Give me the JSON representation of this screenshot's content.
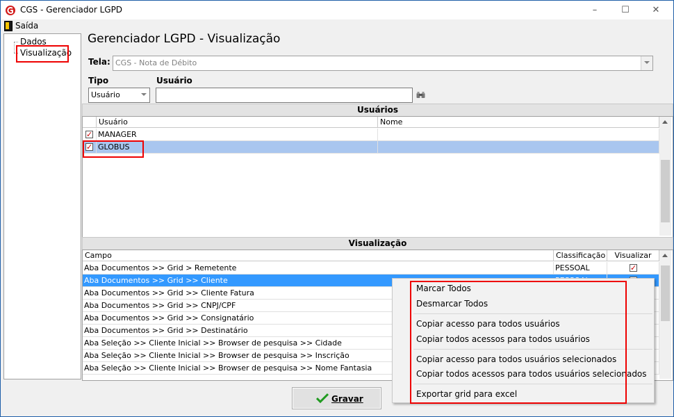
{
  "window": {
    "title": "CGS - Gerenciador LGPD"
  },
  "menu": {
    "saida": "Saída"
  },
  "tree": {
    "items": [
      "Dados",
      "Visualização"
    ]
  },
  "page": {
    "title": "Gerenciador LGPD - Visualização"
  },
  "form": {
    "tela_label": "Tela:",
    "tela_value": "CGS - Nota de Débito",
    "tipo_label": "Tipo",
    "tipo_value": "Usuário",
    "usuario_label": "Usuário",
    "usuario_value": ""
  },
  "usuarios": {
    "caption": "Usuários",
    "columns": [
      "Usuário",
      "Nome"
    ],
    "rows": [
      {
        "usuario": "MANAGER",
        "nome": "",
        "checked": true
      },
      {
        "usuario": "GLOBUS",
        "nome": "",
        "checked": true
      }
    ]
  },
  "visualizacao": {
    "caption": "Visualização",
    "columns": [
      "Campo",
      "Classificação",
      "Visualizar"
    ],
    "rows": [
      {
        "campo": "Aba Documentos >> Grid > Remetente",
        "classificacao": "PESSOAL",
        "visualizar": true
      },
      {
        "campo": "Aba Documentos >> Grid >> Cliente",
        "classificacao": "PESSOAL",
        "visualizar": true
      },
      {
        "campo": "Aba Documentos >> Grid >> Cliente Fatura",
        "classificacao": "",
        "visualizar": false
      },
      {
        "campo": "Aba Documentos >> Grid >> CNPJ/CPF",
        "classificacao": "",
        "visualizar": false
      },
      {
        "campo": "Aba Documentos >> Grid >> Consignatário",
        "classificacao": "",
        "visualizar": false
      },
      {
        "campo": "Aba Documentos >> Grid >> Destinatário",
        "classificacao": "",
        "visualizar": false
      },
      {
        "campo": "Aba Seleção >> Cliente Inicial >> Browser de pesquisa >> Cidade",
        "classificacao": "",
        "visualizar": false
      },
      {
        "campo": "Aba Seleção >> Cliente Inicial >> Browser de pesquisa >> Inscrição",
        "classificacao": "",
        "visualizar": false
      },
      {
        "campo": "Aba Seleção >> Cliente Inicial >> Browser de pesquisa >> Nome Fantasia",
        "classificacao": "",
        "visualizar": false
      }
    ]
  },
  "context_menu": {
    "items": [
      "Marcar Todos",
      "Desmarcar Todos",
      "Copiar acesso para todos usuários",
      "Copiar todos acessos para todos usuários",
      "Copiar acesso para todos usuários selecionados",
      "Copiar todos acessos para todos usuários selecionados",
      "Exportar grid para excel"
    ]
  },
  "buttons": {
    "gravar": "Gravar"
  },
  "colors": {
    "highlight": "#3399ff",
    "annotation": "#e00000",
    "selected_row_light": "#a9c6ef"
  }
}
